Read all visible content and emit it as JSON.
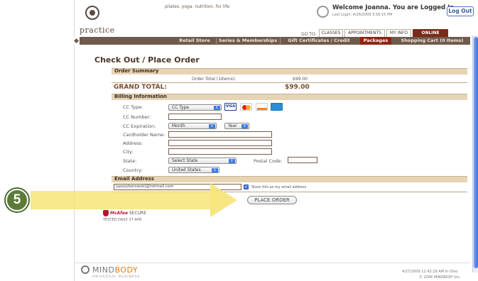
{
  "header": {
    "logo_text": "practice",
    "tagline": "pilates. yoga. nutrition. for life",
    "welcome": "Welcome Joanna.  You are Logged In.",
    "last_login": "Last Login: 4/26/2009 3:58:15 PM",
    "logout_label": "Log Out",
    "goto_label": "GO TO:",
    "top_tabs": [
      "CLASSES",
      "APPOINTMENTS",
      "MY INFO",
      "ONLINE STORE"
    ],
    "active_top_tab": "ONLINE STORE"
  },
  "nav": {
    "items": [
      "Retail Store",
      "Series & Memberships",
      "Gift Certificates / Credit",
      "Packages",
      "Shopping Cart (0 Items)"
    ],
    "active": "Packages"
  },
  "checkout": {
    "title": "Check Out / Place Order",
    "order_summary_label": "Order Summary",
    "order_total_label": "Order Total (1Items):",
    "order_total_value": "$99.00",
    "grand_total_label": "GRAND TOTAL:",
    "grand_total_value": "$99.00",
    "billing_label": "Billing Information",
    "fields": {
      "cc_type_label": "CC Type:",
      "cc_type_value": "CC Type",
      "cc_number_label": "CC Number:",
      "cc_expiration_label": "CC Expiration:",
      "month_value": "Month",
      "year_value": "Year",
      "cardholder_label": "Cardholder Name:",
      "address_label": "Address:",
      "city_label": "City:",
      "state_label": "State:",
      "state_value": "Select State",
      "postal_label": "Postal Code:",
      "country_label": "Country:",
      "country_value": "United States"
    },
    "cards": [
      "VISA",
      "MC",
      "AMEX",
      "DISC"
    ],
    "email_label": "Email Address",
    "email_value": "jspozyborowski@hotmail.com",
    "store_email_label": "Store this as my email address",
    "store_email_checked": true,
    "place_order_label": "PLACE ORDER"
  },
  "security": {
    "badge_brand": "McAfee",
    "badge_text": "SECURE",
    "tested": "TESTED DAILY   27-APR"
  },
  "footer": {
    "brand_part1": "MIND",
    "brand_part2": "BODY",
    "brand_sub": "UNIVERSAL BUSINESS",
    "timestamp": "4/27/2009 11:42:29 AM in Ohio",
    "copyright": "© 2006 MINDBODY Inc."
  },
  "overlay": {
    "step_number": "5",
    "arrow_color": "#f6e578",
    "badge_color": "#5c7a3a"
  }
}
